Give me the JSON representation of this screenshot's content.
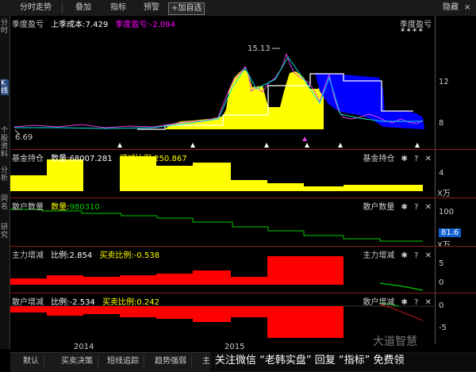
{
  "toolbar": {
    "fenshi": "分时走势",
    "overlay": "叠加",
    "indicator": "指标",
    "alert": "预警",
    "add_watch": "+加自选",
    "hide": "隐藏",
    "close": "×"
  },
  "left_tabs": [
    "分时",
    "K线",
    "个股资料",
    "分析",
    "同名",
    "研究"
  ],
  "panel1": {
    "name": "季度盈亏",
    "last_cost_label": "上季成本:",
    "last_cost_value": "7.429",
    "profit_label": "季度盈亏:",
    "profit_value": "-2.094",
    "right_label": "季度盈亏",
    "high_label": "15.13",
    "low_label": "6.69",
    "yticks": [
      "12",
      "8"
    ]
  },
  "panel2": {
    "name": "基金持仓",
    "qty_label": "数量:",
    "qty_value": "68007.281",
    "ratio_label": "增减比例:",
    "ratio_value": "250.867",
    "right_label": "基金持仓",
    "yticks": [
      "4",
      "X万"
    ]
  },
  "panel3": {
    "name": "散户数量",
    "qty_label": "数量:",
    "qty_value": "980310",
    "right_label": "散户数量",
    "yticks": [
      "100",
      "81.6",
      "X万"
    ]
  },
  "panel4": {
    "name": "主力增减",
    "ratio_label": "比例:",
    "ratio_value": "2.854",
    "trade_label": "买卖比例:",
    "trade_value": "-0.538",
    "right_label": "主力增减",
    "yticks": [
      "5",
      "0"
    ]
  },
  "panel5": {
    "name": "散户增减",
    "ratio_label": "比例:",
    "ratio_value": "-2.534",
    "trade_label": "买卖比例:",
    "trade_value": "0.242",
    "right_label": "散户增减",
    "yticks": [
      "0",
      "-5"
    ]
  },
  "icons": {
    "gear": "gear-icon",
    "help": "help-icon",
    "close": "close-icon"
  },
  "xaxis": [
    "2014",
    "2015"
  ],
  "bottom_tabs": [
    "默认",
    "买卖决策",
    "短线追踪",
    "趋势强弱",
    "主"
  ],
  "banner": "关注微信 “老韩实盘” 回复 “指标” 免费领",
  "watermark": "大道智慧",
  "colors": {
    "yellow": "#ffff00",
    "red": "#ff0000",
    "blue": "#0000ff",
    "green": "#00cc00",
    "cyan": "#00e0e0"
  }
}
